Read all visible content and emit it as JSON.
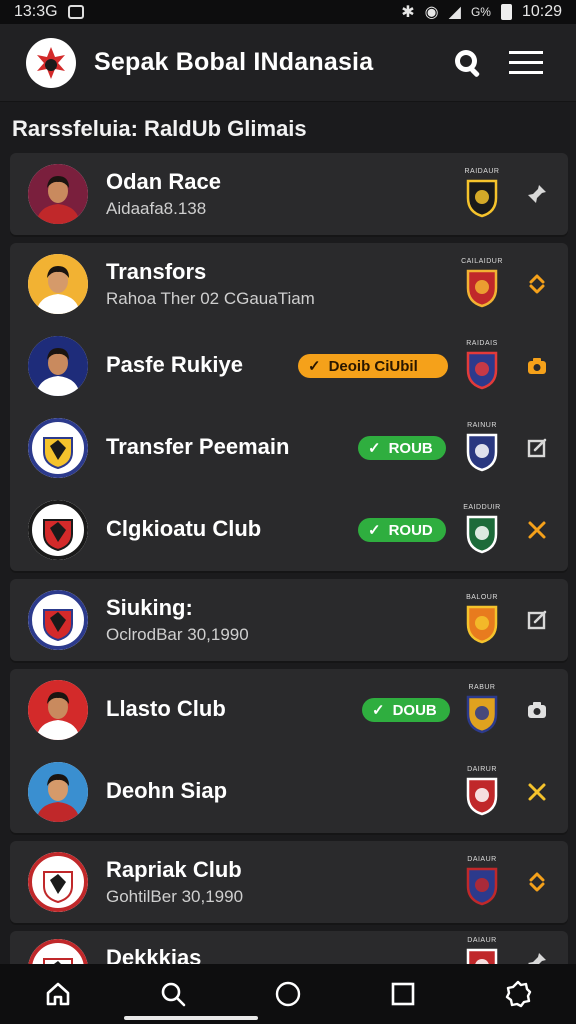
{
  "status_bar": {
    "time_left": "13:3G",
    "time_right": "10:29",
    "signal_text": "G%"
  },
  "app": {
    "title": "Sepak Bobal INdanasia"
  },
  "section": {
    "title": "Rarssfeluia: RaldUb Glimais"
  },
  "colors": {
    "accent_orange": "#f5a11a",
    "accent_green": "#2fae3f",
    "background": "#1b1b1d",
    "card": "#2a2a2c"
  },
  "items": [
    {
      "name": "Odan Race",
      "sub": "Aidaafa8.138",
      "crest_caption": "RAIDAUR",
      "crest_color": "#1a1a1a",
      "crest_accent": "#f5c32c",
      "action_icon": "pin-icon",
      "action_color": "#d8d8d8"
    },
    {
      "name": "Transfors",
      "sub": "Rahoa Ther 02 CGauaTiam",
      "crest_caption": "CAILAIDUR",
      "crest_color": "#c0282a",
      "crest_accent": "#f2b233",
      "action_icon": "transfer-icon",
      "action_color": "#f5a11a"
    },
    {
      "name": "Pasfe Rukiye",
      "badge": "Deoib CiUbil",
      "badge_type": "orange",
      "crest_caption": "RAIDAIS",
      "crest_color": "#2c3a8c",
      "crest_accent": "#e23a3a",
      "action_icon": "camera-icon",
      "action_color": "#f5a11a"
    },
    {
      "name": "Transfer Peemain",
      "badge": "ROUB",
      "badge_type": "green",
      "crest_caption": "RAINUR",
      "crest_color": "#2a3880",
      "crest_accent": "#ffffff",
      "action_icon": "edit-icon",
      "action_color": "#d8d8d8"
    },
    {
      "name": "Clgkioatu Club",
      "badge": "ROUD",
      "badge_type": "green",
      "crest_caption": "EAIDDUIR",
      "crest_color": "#1d6b3a",
      "crest_accent": "#ffffff",
      "action_icon": "close-icon",
      "action_color": "#f5a11a"
    },
    {
      "name": "Siuking:",
      "sub": "OclrodBar 30,1990",
      "crest_caption": "BALOUR",
      "crest_color": "#e87b1e",
      "crest_accent": "#f5c32c",
      "action_icon": "edit-icon",
      "action_color": "#d8d8d8"
    },
    {
      "name": "Llasto Club",
      "badge": "DOUB",
      "badge_type": "green",
      "crest_caption": "RABUR",
      "crest_color": "#e0a21f",
      "crest_accent": "#2c3a8c",
      "action_icon": "camera-icon",
      "action_color": "#e0e0e0"
    },
    {
      "name": "Deohn Siap",
      "crest_caption": "DAIRUR",
      "crest_color": "#c0282a",
      "crest_accent": "#ffffff",
      "action_icon": "close-icon",
      "action_color": "#f5c32c"
    },
    {
      "name": "Rapriak Club",
      "sub": "GohtilBer 30,1990",
      "crest_caption": "DAIAUR",
      "crest_color": "#2c3a8c",
      "crest_accent": "#c0282a",
      "action_icon": "transfer-icon",
      "action_color": "#f5a11a"
    },
    {
      "name": "Dekkkias",
      "crest_caption": "DAIAUR",
      "crest_color": "#c0282a",
      "crest_accent": "#ffffff",
      "action_icon": "pin-icon",
      "action_color": "#d8d8d8"
    }
  ],
  "nav": [
    {
      "name": "home-icon"
    },
    {
      "name": "search-icon"
    },
    {
      "name": "circle-icon"
    },
    {
      "name": "square-icon"
    },
    {
      "name": "settings-icon"
    }
  ]
}
